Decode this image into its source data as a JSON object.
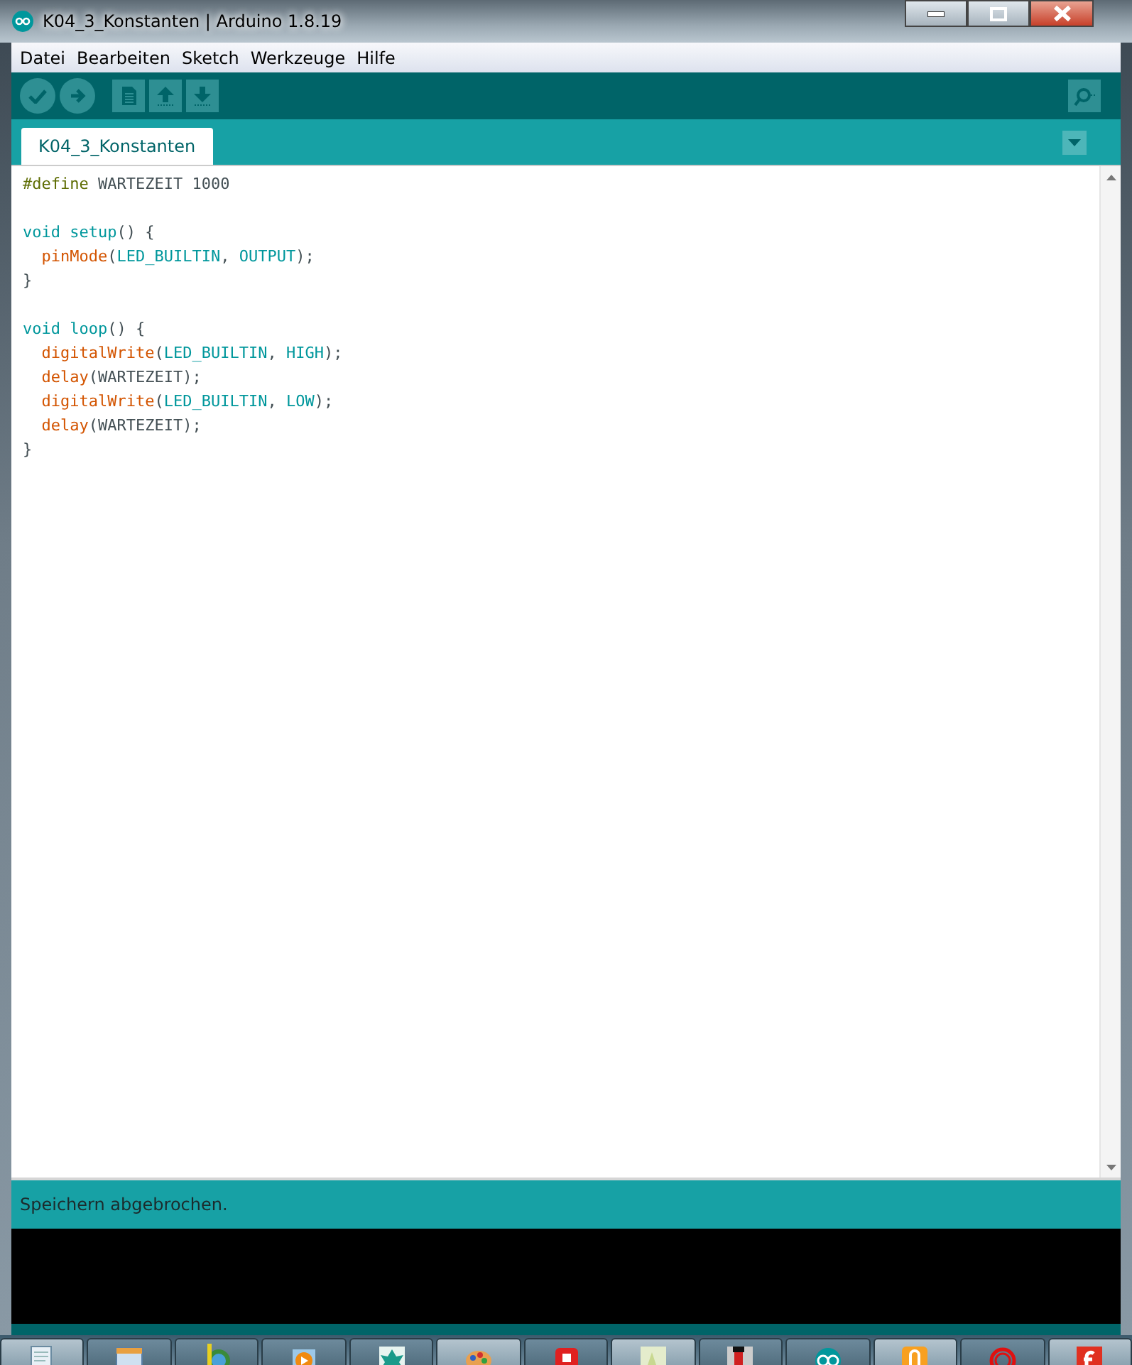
{
  "window": {
    "title": "K04_3_Konstanten | Arduino 1.8.19"
  },
  "menu": [
    "Datei",
    "Bearbeiten",
    "Sketch",
    "Werkzeuge",
    "Hilfe"
  ],
  "tabs": [
    {
      "label": "K04_3_Konstanten",
      "selected": true
    }
  ],
  "code": {
    "lines": [
      {
        "kind": "code",
        "tokens": [
          {
            "text": "#define",
            "kind": "directive"
          },
          {
            "text": " WARTEZEIT 1000",
            "kind": "plain"
          }
        ]
      },
      {
        "kind": "blank"
      },
      {
        "kind": "code",
        "tokens": [
          {
            "text": "void setup",
            "kind": "keyword"
          },
          {
            "text": "() {",
            "kind": "plain"
          }
        ]
      },
      {
        "kind": "code",
        "tokens": [
          {
            "text": "  pinMode",
            "kind": "function"
          },
          {
            "text": "(",
            "kind": "plain"
          },
          {
            "text": "LED_BUILTIN",
            "kind": "constant"
          },
          {
            "text": ", ",
            "kind": "plain"
          },
          {
            "text": "OUTPUT",
            "kind": "constant"
          },
          {
            "text": ");",
            "kind": "plain"
          }
        ]
      },
      {
        "kind": "code",
        "tokens": [
          {
            "text": "}",
            "kind": "plain"
          }
        ]
      },
      {
        "kind": "blank"
      },
      {
        "kind": "code",
        "tokens": [
          {
            "text": "void loop",
            "kind": "keyword"
          },
          {
            "text": "() {",
            "kind": "plain"
          }
        ]
      },
      {
        "kind": "code",
        "tokens": [
          {
            "text": "  digitalWrite",
            "kind": "function"
          },
          {
            "text": "(",
            "kind": "plain"
          },
          {
            "text": "LED_BUILTIN",
            "kind": "constant"
          },
          {
            "text": ", ",
            "kind": "plain"
          },
          {
            "text": "HIGH",
            "kind": "constant"
          },
          {
            "text": ");",
            "kind": "plain"
          }
        ]
      },
      {
        "kind": "code",
        "tokens": [
          {
            "text": "  delay",
            "kind": "function"
          },
          {
            "text": "(WARTEZEIT);",
            "kind": "plain"
          }
        ]
      },
      {
        "kind": "code",
        "tokens": [
          {
            "text": "  digitalWrite",
            "kind": "function"
          },
          {
            "text": "(",
            "kind": "plain"
          },
          {
            "text": "LED_BUILTIN",
            "kind": "constant"
          },
          {
            "text": ", ",
            "kind": "plain"
          },
          {
            "text": "LOW",
            "kind": "constant"
          },
          {
            "text": ");",
            "kind": "plain"
          }
        ]
      },
      {
        "kind": "code",
        "tokens": [
          {
            "text": "  delay",
            "kind": "function"
          },
          {
            "text": "(WARTEZEIT);",
            "kind": "plain"
          }
        ]
      },
      {
        "kind": "code",
        "tokens": [
          {
            "text": "}",
            "kind": "plain"
          }
        ]
      }
    ]
  },
  "status_bar": {
    "message": "Speichern abgebrochen."
  },
  "taskbar": {
    "items": [
      {
        "open": true
      },
      {
        "open": false
      },
      {
        "open": false
      },
      {
        "open": false
      },
      {
        "open": false
      },
      {
        "open": true
      },
      {
        "open": false
      },
      {
        "open": true
      },
      {
        "open": false
      },
      {
        "open": false
      },
      {
        "open": true
      },
      {
        "open": false
      },
      {
        "open": true
      }
    ]
  }
}
